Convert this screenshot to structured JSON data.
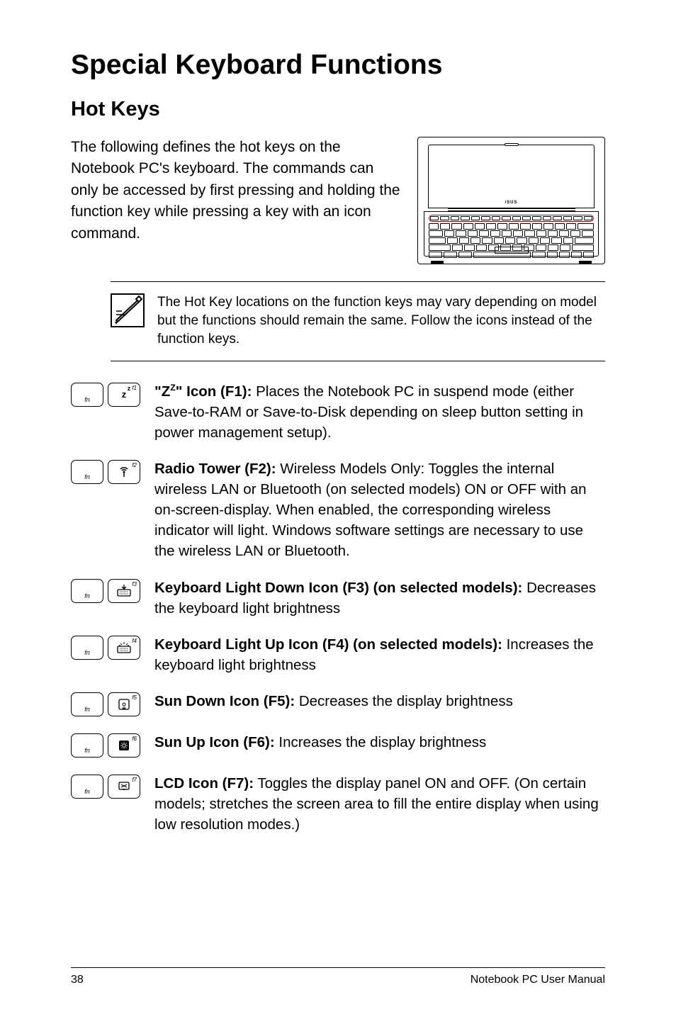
{
  "title": "Special Keyboard Functions",
  "subtitle": "Hot Keys",
  "intro": "The following defines the hot keys on the Notebook PC's keyboard. The commands can only be accessed by first pressing and holding the function key while pressing a key with an icon command.",
  "note": "The Hot Key locations on the function keys may vary depending on model but the functions should remain the same. Follow the icons instead of the function keys.",
  "fn_label": "fn",
  "items": [
    {
      "key_corner": "f1",
      "icon": "zz",
      "title_pre": "\"Z",
      "title_sup": "Z",
      "title_post": "\" Icon (F1):",
      "desc": " Places the Notebook PC in suspend mode (either Save-to-RAM or Save-to-Disk depending on sleep button setting in power management setup)."
    },
    {
      "key_corner": "f2",
      "icon": "radio",
      "title": "Radio Tower (F2):",
      "desc": " Wireless Models Only: Toggles the internal wireless LAN or Bluetooth (on selected models) ON or OFF with an on-screen-display. When enabled, the corresponding wireless indicator will light. Windows software settings are necessary to use the wireless LAN or Bluetooth."
    },
    {
      "key_corner": "f3",
      "icon": "kbdown",
      "title": "Keyboard Light Down Icon (F3) (on selected models):",
      "desc": " Decreases the keyboard light brightness"
    },
    {
      "key_corner": "f4",
      "icon": "kbup",
      "title": "Keyboard Light Up Icon (F4) (on selected models):",
      "desc": " Increases the keyboard light brightness"
    },
    {
      "key_corner": "f5",
      "icon": "sundown",
      "title": "Sun Down Icon (F5):",
      "desc": " Decreases the display brightness"
    },
    {
      "key_corner": "f6",
      "icon": "sunup",
      "title": "Sun Up Icon (F6):",
      "desc": " Increases the display brightness"
    },
    {
      "key_corner": "f7",
      "icon": "lcd",
      "title": "LCD Icon (F7):",
      "desc": " Toggles the display panel ON and OFF. (On certain models; stretches the screen area to fill the entire display when using low resolution modes.)"
    }
  ],
  "page_number": "38",
  "footer_right": "Notebook PC User Manual"
}
